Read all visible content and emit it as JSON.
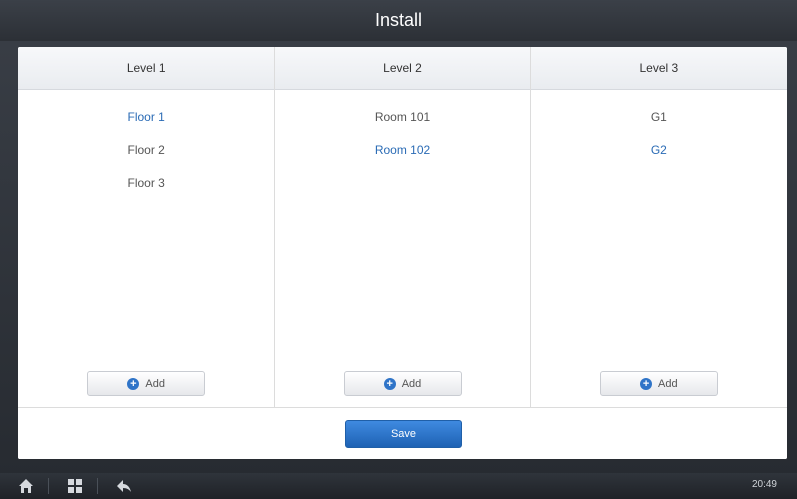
{
  "title": "Install",
  "columns": [
    {
      "header": "Level 1",
      "items": [
        {
          "label": "Floor 1",
          "selected": true
        },
        {
          "label": "Floor 2",
          "selected": false
        },
        {
          "label": "Floor 3",
          "selected": false
        }
      ]
    },
    {
      "header": "Level 2",
      "items": [
        {
          "label": "Room 101",
          "selected": false
        },
        {
          "label": "Room 102",
          "selected": true
        }
      ]
    },
    {
      "header": "Level 3",
      "items": [
        {
          "label": "G1",
          "selected": false
        },
        {
          "label": "G2",
          "selected": true
        }
      ]
    }
  ],
  "add_label": "Add",
  "save_label": "Save",
  "taskbar": {
    "icons": [
      "home-icon",
      "grid-icon",
      "back-icon"
    ],
    "time": "20:49"
  },
  "colors": {
    "selected_text": "#2a6bb5",
    "save_button": "#2f74c8"
  }
}
